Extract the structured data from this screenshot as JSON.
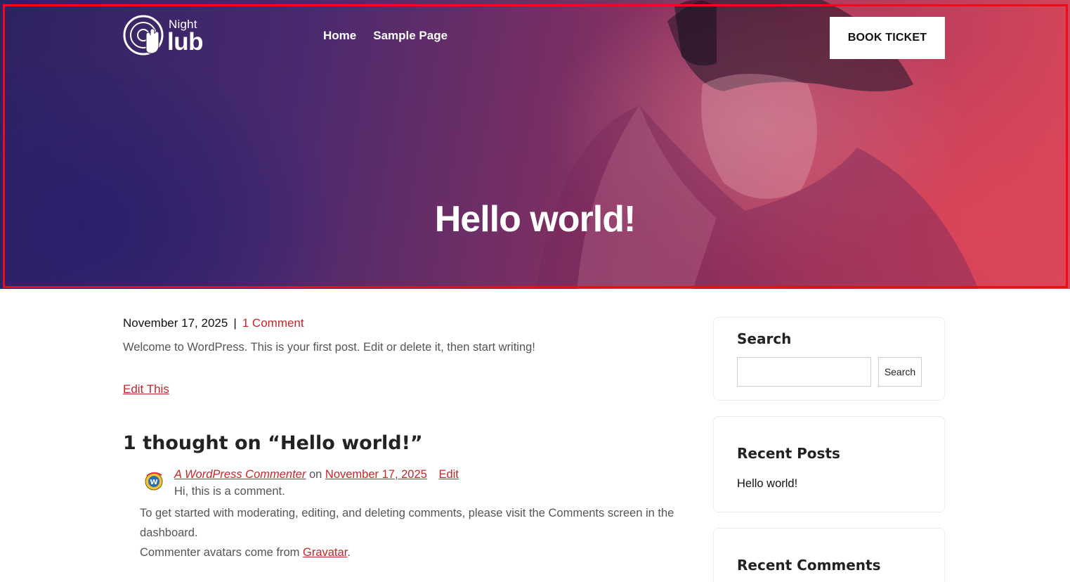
{
  "header": {
    "logo_top": "Night",
    "logo_bottom": "lub",
    "nav": [
      "Home",
      "Sample Page"
    ],
    "cta_label": "BOOK TICKET"
  },
  "hero": {
    "title": "Hello world!"
  },
  "post": {
    "date": "November 17, 2025",
    "separator": "|",
    "comment_count": "1 Comment",
    "excerpt": "Welcome to WordPress. This is your first post. Edit or delete it, then start writing!",
    "edit_label": "Edit This"
  },
  "comments": {
    "title": "1 thought on “Hello world!”",
    "items": [
      {
        "author": "A WordPress Commenter",
        "on": "on",
        "date": "November 17, 2025",
        "edit": "Edit",
        "line1": "Hi, this is a comment.",
        "line2": "To get started with moderating, editing, and deleting comments, please visit the Comments screen in the dashboard.",
        "line3_prefix": "Commenter avatars come from",
        "line3_link": "Gravatar",
        "line3_suffix": "."
      }
    ]
  },
  "sidebar": {
    "search": {
      "title": "Search",
      "placeholder": "",
      "button": "Search"
    },
    "recent_posts": {
      "title": "Recent Posts",
      "items": [
        "Hello world!"
      ]
    },
    "recent_comments": {
      "title": "Recent Comments"
    }
  },
  "colors": {
    "accent": "#c8242b",
    "frame": "#f20a14",
    "hero_left": "#2d2262",
    "hero_right": "#d9475b"
  }
}
